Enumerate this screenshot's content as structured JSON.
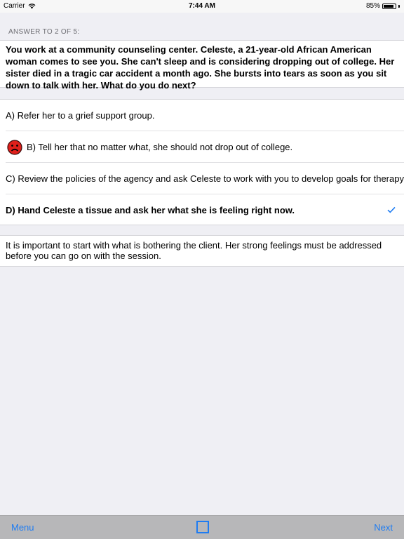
{
  "status_bar": {
    "carrier": "Carrier",
    "time": "7:44 AM",
    "battery_percent": "85%",
    "battery_level": 0.85
  },
  "section_header": "ANSWER TO 2 OF 5:",
  "question": "You work at a community counseling center. Celeste, a 21-year-old African American woman comes to see you. She can't sleep and is considering dropping out of college. Her sister died in a tragic car accident a month ago. She bursts into tears as soon as you sit down to talk with her. What do you do next?",
  "answers": [
    {
      "label": "A) Refer her to a grief support group.",
      "state": "neutral"
    },
    {
      "label": "B) Tell her that no matter what, she should not drop out of college.",
      "state": "wrong",
      "icon": "sad-face-icon"
    },
    {
      "label": "C) Review the policies of the agency and ask Celeste to work with you to develop goals for therapy.",
      "state": "neutral"
    },
    {
      "label": "D) Hand Celeste a tissue and ask her what she is feeling right now.",
      "state": "correct",
      "icon": "checkmark-icon"
    }
  ],
  "explanation": "It is important to start with what is bothering the client. Her strong feelings must be addressed before you can go on with the session.",
  "toolbar": {
    "menu_label": "Menu",
    "next_label": "Next",
    "center_icon": "square-icon"
  },
  "colors": {
    "accent": "#1e7cf2",
    "background": "#efeff4",
    "toolbar": "#b7b7b9",
    "wrong_icon": "#e0201b"
  }
}
